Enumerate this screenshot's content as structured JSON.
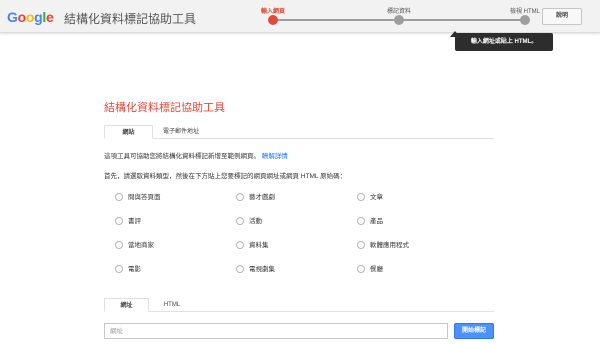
{
  "header": {
    "logo": [
      "G",
      "o",
      "o",
      "g",
      "l",
      "e"
    ],
    "logo_colors": [
      "#4285f4",
      "#ea4335",
      "#fbbc05",
      "#4285f4",
      "#34a853",
      "#ea4335"
    ],
    "app_title": "結構化資料標記協助工具",
    "steps": [
      "輸入網頁",
      "標記資料",
      "檢視 HTML"
    ],
    "help_label": "說明"
  },
  "tooltip": "輸入網址或貼上 HTML。",
  "main": {
    "title": "結構化資料標記協助工具",
    "tabs": [
      "網站",
      "電子郵件地址"
    ],
    "description": "這項工具可協助您將結構化資料標記新增至範例網頁。",
    "learn_more": "瞭解詳情",
    "instruction": "首先，請選取資料類型，然後在下方貼上您要標記的網頁網址或網頁 HTML 原始碼：",
    "data_types": [
      [
        "問與答頁面",
        "藝才戲劇",
        "文章"
      ],
      [
        "書評",
        "活動",
        "產品"
      ],
      [
        "當地商家",
        "資料集",
        "軟體應用程式"
      ],
      [
        "電影",
        "電視劇集",
        "餐廳"
      ]
    ],
    "input_tabs": [
      "網址",
      "HTML"
    ],
    "url_placeholder": "網址",
    "start_button": "開始標記"
  }
}
